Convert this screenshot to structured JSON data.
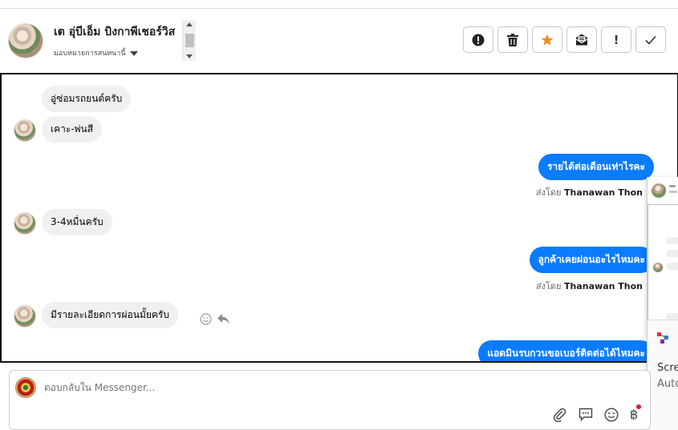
{
  "header": {
    "contact_name": "เต อุ่บีเอ็ม บิงกาพีเชอร์วิส",
    "assign_label": "มอบหมายการสนทนานี้",
    "actions": [
      {
        "name": "report-spam-button",
        "icon": "alert-circle-icon"
      },
      {
        "name": "delete-button",
        "icon": "trash-icon"
      },
      {
        "name": "star-button",
        "icon": "star-icon",
        "color": "#f28c28"
      },
      {
        "name": "mark-unread-button",
        "icon": "envelope-icon"
      },
      {
        "name": "priority-button",
        "label": "!"
      },
      {
        "name": "mark-done-button",
        "icon": "check-icon"
      }
    ]
  },
  "thread": {
    "messages": [
      {
        "direction": "in",
        "text": "อู่ซ่อมรถยนต์ครับ"
      },
      {
        "direction": "in",
        "text": "เคาะ-พ่นสี"
      },
      {
        "direction": "out",
        "text": "รายได้ต่อเดือนเท่าไรคะ",
        "sent_by_prefix": "ส่งโดย",
        "sent_by": "Thanawan Thon"
      },
      {
        "direction": "in",
        "text": "3-4หมื่นครับ"
      },
      {
        "direction": "out",
        "text": "ลูกค้าเคยผ่อนอะไรไหมคะ",
        "sent_by_prefix": "ส่งโดย",
        "sent_by": "Thanawan Thon"
      },
      {
        "direction": "in",
        "text": "มีรายละเอียดการผ่อนมั้ยครับ"
      },
      {
        "direction": "out",
        "text": "แอดมินรบกวนขอเบอร์ติดต่อได้ไหมคะ"
      }
    ]
  },
  "overlay": {
    "app_lines": [
      "Scre",
      "Auto"
    ]
  },
  "composer": {
    "placeholder": "ตอบกลับใน Messenger...",
    "currency_symbol": "฿"
  },
  "colors": {
    "outgoing_bubble": "#0a7cff",
    "incoming_bubble": "#f0f0f0",
    "star": "#f28c28"
  }
}
